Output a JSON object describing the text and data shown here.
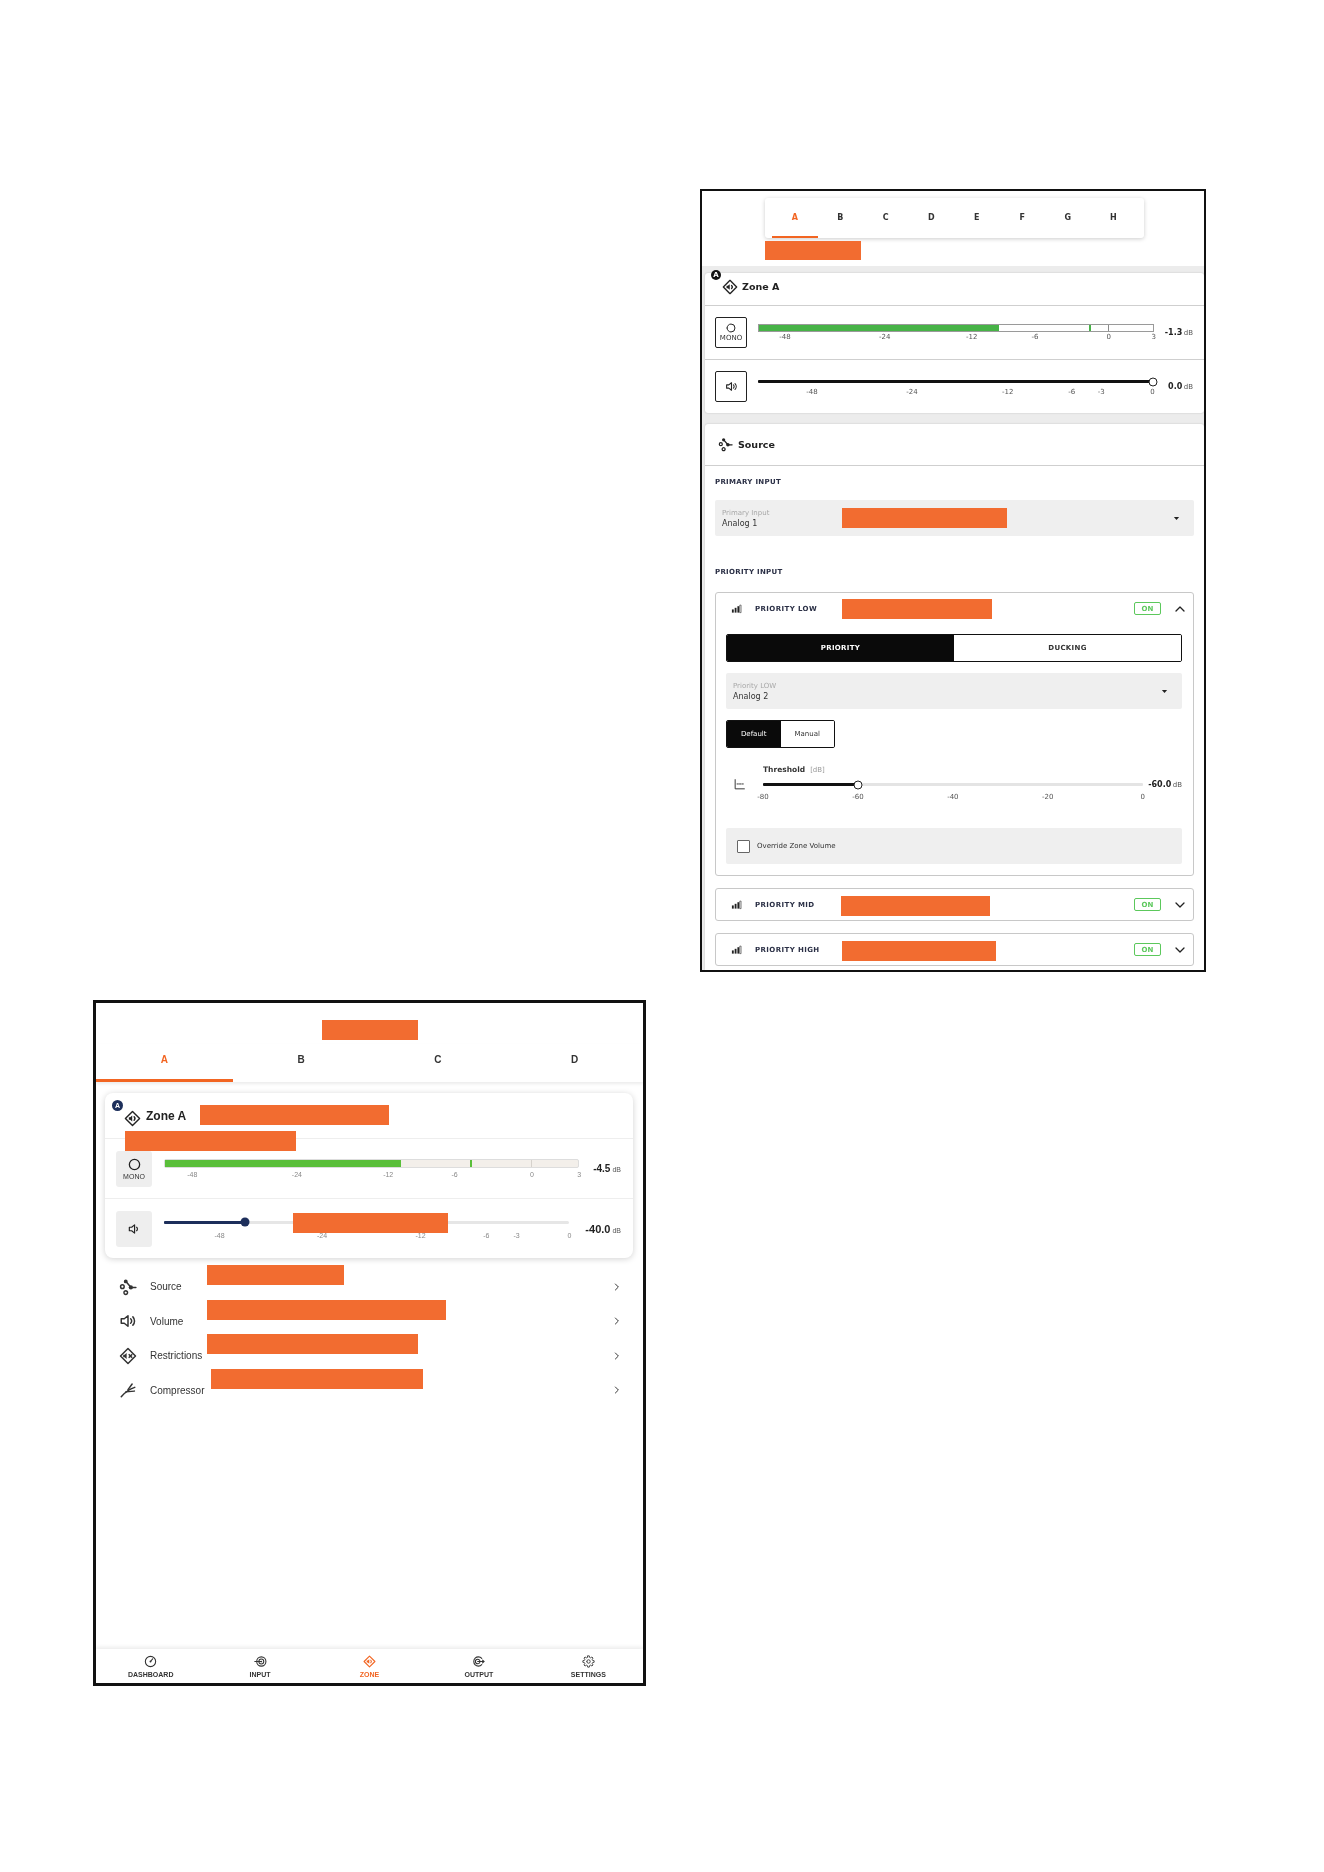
{
  "desktop_view": {
    "tabs": [
      {
        "label": "A",
        "selected": true
      },
      {
        "label": "B",
        "selected": false
      },
      {
        "label": "C",
        "selected": false
      },
      {
        "label": "D",
        "selected": false
      },
      {
        "label": "E",
        "selected": false
      },
      {
        "label": "F",
        "selected": false
      },
      {
        "label": "G",
        "selected": false
      },
      {
        "label": "H",
        "selected": false
      }
    ],
    "zone": {
      "badge": "A",
      "title": "Zone A",
      "meter": {
        "button": "MONO",
        "level": 0.61,
        "peak_marker": {
          "level": 0.84
        },
        "ticks": [
          "-48",
          "-24",
          "-12",
          "-6",
          "0",
          "3"
        ],
        "reading": "-1.3",
        "unit": "dB"
      },
      "volume": {
        "level": 1,
        "ticks": [
          "-48",
          "-24",
          "-12",
          "-6",
          "-3",
          "0"
        ],
        "reading": "0.0",
        "unit": "dB"
      }
    },
    "source": {
      "title": "Source",
      "primary_heading": "PRIMARY INPUT",
      "primary_field": {
        "label": "Primary Input",
        "value": "Analog 1"
      },
      "priority_heading": "PRIORITY INPUT",
      "priorities": [
        {
          "title": "PRIORITY LOW",
          "status": "ON",
          "enabled": true,
          "expanded": true,
          "modes": [
            {
              "label": "PRIORITY",
              "selected": true
            },
            {
              "label": "DUCKING",
              "selected": false
            }
          ],
          "field": {
            "label": "Priority LOW",
            "value": "Analog 2"
          },
          "presets": [
            {
              "label": "Default",
              "selected": true
            },
            {
              "label": "Manual",
              "selected": false
            }
          ],
          "threshold": {
            "label": "Threshold",
            "unit": "[dB]",
            "level": 0.25,
            "ticks": [
              "-80",
              "-60",
              "-40",
              "-20",
              "0"
            ],
            "reading": "-60.0",
            "reading_unit": "dB"
          },
          "override": {
            "label": "Override Zone Volume",
            "checked": false
          }
        },
        {
          "title": "PRIORITY MID",
          "status": "ON",
          "enabled": true,
          "expanded": false
        },
        {
          "title": "PRIORITY HIGH",
          "status": "ON",
          "enabled": true,
          "expanded": false
        }
      ]
    }
  },
  "mobile_view": {
    "tabs": [
      {
        "label": "A",
        "selected": true
      },
      {
        "label": "B",
        "selected": false
      },
      {
        "label": "C",
        "selected": false
      },
      {
        "label": "D",
        "selected": false
      }
    ],
    "zone": {
      "badge": "A",
      "title": "Zone A",
      "meter": {
        "button": "MONO",
        "level": 0.57,
        "peak_marker": {
          "level": 0.74
        },
        "ticks": [
          "-48",
          "-24",
          "-12",
          "-6",
          "0",
          "3"
        ],
        "reading": "-4.5",
        "unit": "dB"
      },
      "volume": {
        "level": 0.2,
        "ticks": [
          "-48",
          "-24",
          "-12",
          "-6",
          "-3",
          "0"
        ],
        "reading": "-40.0",
        "unit": "dB"
      }
    },
    "menu": [
      {
        "label": "Source"
      },
      {
        "label": "Volume"
      },
      {
        "label": "Restrictions"
      },
      {
        "label": "Compressor"
      }
    ],
    "nav": [
      {
        "label": "DASHBOARD",
        "selected": false
      },
      {
        "label": "INPUT",
        "selected": false
      },
      {
        "label": "ZONE",
        "selected": true
      },
      {
        "label": "OUTPUT",
        "selected": false
      },
      {
        "label": "SETTINGS",
        "selected": false
      }
    ]
  }
}
